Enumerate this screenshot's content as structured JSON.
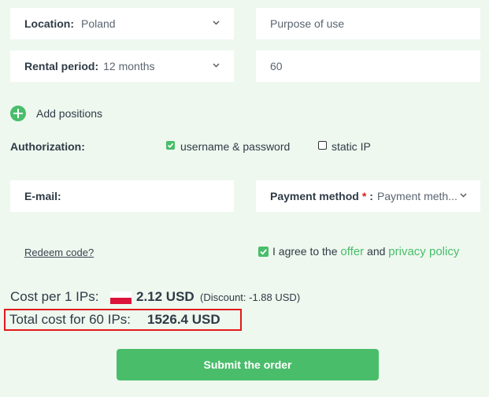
{
  "location": {
    "label": "Location:",
    "value": "Poland"
  },
  "purpose": {
    "placeholder": "Purpose of use"
  },
  "rental": {
    "label": "Rental period:",
    "value": "12 months"
  },
  "quantity": {
    "value": "60"
  },
  "add_positions": {
    "label": "Add positions"
  },
  "authorization": {
    "label": "Authorization:",
    "options": [
      {
        "label": "username & password",
        "checked": true
      },
      {
        "label": "static IP",
        "checked": false
      }
    ]
  },
  "email": {
    "label": "E-mail:"
  },
  "payment": {
    "label": "Payment method",
    "required_mark": "*",
    "colon": ":",
    "value": "Payment meth..."
  },
  "redeem": {
    "label": "Redeem code?"
  },
  "agree": {
    "checked": true,
    "prefix": "I agree to the",
    "offer": "offer",
    "and": "and",
    "privacy": "privacy policy"
  },
  "cost": {
    "per_label": "Cost per 1 IPs:",
    "per_value": "2.12 USD",
    "discount": "(Discount: -1.88 USD)",
    "total_label": "Total cost for 60 IPs:",
    "total_value": "1526.4 USD"
  },
  "submit": {
    "label": "Submit the order"
  },
  "colors": {
    "accent": "#49bd6a",
    "highlight": "#e01b1b",
    "background": "#eef8ef"
  },
  "icons": [
    "chevron-down-icon",
    "plus-circle-icon",
    "checkbox-checked-icon",
    "checkbox-unchecked-icon",
    "poland-flag-icon"
  ]
}
